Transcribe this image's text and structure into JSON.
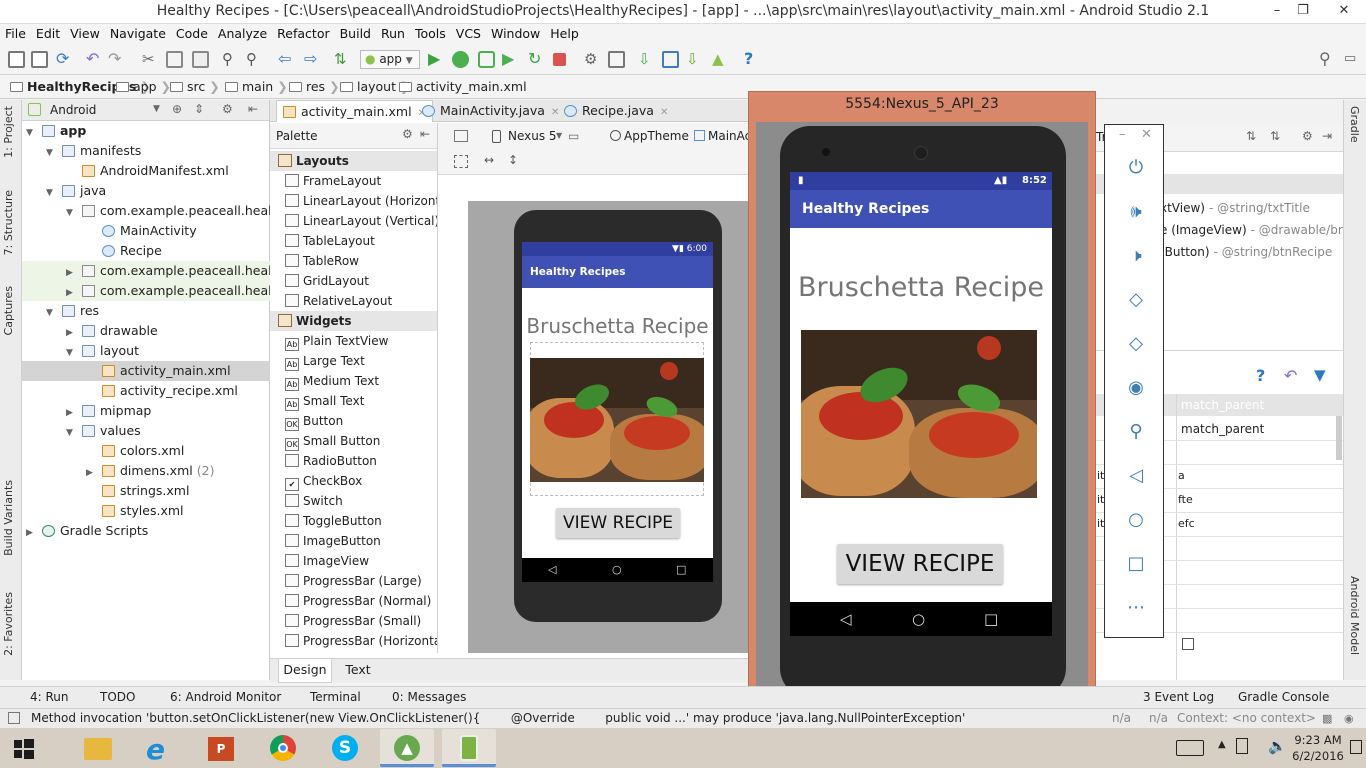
{
  "window": {
    "title": "Healthy Recipes - [C:\\Users\\peaceall\\AndroidStudioProjects\\HealthyRecipes] - [app] - ...\\app\\src\\main\\res\\layout\\activity_main.xml - Android Studio 2.1"
  },
  "menu": [
    "File",
    "Edit",
    "View",
    "Navigate",
    "Code",
    "Analyze",
    "Refactor",
    "Build",
    "Run",
    "Tools",
    "VCS",
    "Window",
    "Help"
  ],
  "toolbar": {
    "run_config": "app"
  },
  "breadcrumbs": [
    "HealthyRecipes",
    "app",
    "src",
    "main",
    "res",
    "layout",
    "activity_main.xml"
  ],
  "left_tabs": [
    "1: Project",
    "7: Structure",
    "Captures",
    "Build Variants",
    "2: Favorites"
  ],
  "right_tabs": [
    "Gradle",
    "Android Model"
  ],
  "project": {
    "view_mode": "Android",
    "tree": [
      {
        "label": "app",
        "depth": 0,
        "icon": "folder",
        "exp": "open",
        "bold": true
      },
      {
        "label": "manifests",
        "depth": 1,
        "icon": "folder",
        "exp": "open"
      },
      {
        "label": "AndroidManifest.xml",
        "depth": 2,
        "icon": "xml"
      },
      {
        "label": "java",
        "depth": 1,
        "icon": "folder",
        "exp": "open"
      },
      {
        "label": "com.example.peaceall.healthyre",
        "depth": 2,
        "icon": "package",
        "exp": "open"
      },
      {
        "label": "MainActivity",
        "depth": 3,
        "icon": "class"
      },
      {
        "label": "Recipe",
        "depth": 3,
        "icon": "class"
      },
      {
        "label": "com.example.peaceall.healthyre",
        "depth": 2,
        "icon": "package",
        "exp": "closed",
        "style": "pkg"
      },
      {
        "label": "com.example.peaceall.healthyre",
        "depth": 2,
        "icon": "package",
        "exp": "closed",
        "style": "pkg"
      },
      {
        "label": "res",
        "depth": 1,
        "icon": "folder",
        "exp": "open"
      },
      {
        "label": "drawable",
        "depth": 2,
        "icon": "folder",
        "exp": "closed"
      },
      {
        "label": "layout",
        "depth": 2,
        "icon": "folder",
        "exp": "open"
      },
      {
        "label": "activity_main.xml",
        "depth": 3,
        "icon": "xml",
        "style": "sel"
      },
      {
        "label": "activity_recipe.xml",
        "depth": 3,
        "icon": "xml"
      },
      {
        "label": "mipmap",
        "depth": 2,
        "icon": "folder",
        "exp": "closed"
      },
      {
        "label": "values",
        "depth": 2,
        "icon": "folder",
        "exp": "open"
      },
      {
        "label": "colors.xml",
        "depth": 3,
        "icon": "xml"
      },
      {
        "label": "dimens.xml",
        "depth": 3,
        "icon": "xml",
        "exp": "closed",
        "suffix": "(2)"
      },
      {
        "label": "strings.xml",
        "depth": 3,
        "icon": "xml"
      },
      {
        "label": "styles.xml",
        "depth": 3,
        "icon": "xml"
      },
      {
        "label": "Gradle Scripts",
        "depth": 0,
        "icon": "gradle",
        "exp": "closed"
      }
    ]
  },
  "editor_tabs": [
    {
      "label": "activity_main.xml",
      "active": true
    },
    {
      "label": "MainActivity.java"
    },
    {
      "label": "Recipe.java"
    }
  ],
  "palette": {
    "title": "Palette",
    "items": [
      {
        "label": "Layouts",
        "group": true
      },
      {
        "label": "FrameLayout"
      },
      {
        "label": "LinearLayout (Horizontal)"
      },
      {
        "label": "LinearLayout (Vertical)"
      },
      {
        "label": "TableLayout"
      },
      {
        "label": "TableRow"
      },
      {
        "label": "GridLayout"
      },
      {
        "label": "RelativeLayout"
      },
      {
        "label": "Widgets",
        "group": true
      },
      {
        "label": "Plain TextView",
        "glyph": "Ab"
      },
      {
        "label": "Large Text",
        "glyph": "Ab"
      },
      {
        "label": "Medium Text",
        "glyph": "Ab"
      },
      {
        "label": "Small Text",
        "glyph": "Ab"
      },
      {
        "label": "Button",
        "glyph": "OK"
      },
      {
        "label": "Small Button",
        "glyph": "OK"
      },
      {
        "label": "RadioButton"
      },
      {
        "label": "CheckBox",
        "glyph": "✔"
      },
      {
        "label": "Switch"
      },
      {
        "label": "ToggleButton"
      },
      {
        "label": "ImageButton"
      },
      {
        "label": "ImageView"
      },
      {
        "label": "ProgressBar (Large)"
      },
      {
        "label": "ProgressBar (Normal)"
      },
      {
        "label": "ProgressBar (Small)"
      },
      {
        "label": "ProgressBar (Horizontal)"
      }
    ]
  },
  "design_toolbar": {
    "device": "Nexus 5",
    "theme": "AppTheme",
    "activity": "MainAct"
  },
  "preview": {
    "time": "6:00",
    "app_title": "Healthy Recipes",
    "recipe_title": "Bruschetta Recipe",
    "button": "VIEW RECIPE"
  },
  "emulator": {
    "title": "5554:Nexus_5_API_23",
    "time": "8:52",
    "app_title": "Healthy Recipes",
    "recipe_title": "Bruschetta Recipe",
    "button": "VIEW RECIPE"
  },
  "component_tree": [
    {
      "label": "xtView)",
      "value": "- @string/txtTitle"
    },
    {
      "label": "e (ImageView)",
      "value": "- @drawable/brusch"
    },
    {
      "label": "(Button)",
      "value": "- @string/btnRecipe"
    }
  ],
  "properties": {
    "header_value": "match_parent",
    "row_value": "match_parent",
    "partial": [
      "ity",
      "ity",
      "ity"
    ],
    "partial_values": [
      "a",
      "fte",
      "efc"
    ]
  },
  "bottom_tabs": [
    "Design",
    "Text"
  ],
  "tool_windows": {
    "left": [
      "4: Run",
      "TODO",
      "6: Android Monitor",
      "Terminal",
      "0: Messages"
    ],
    "right": [
      "3  Event Log",
      "Gradle Console"
    ]
  },
  "status": {
    "message": "Method invocation 'button.setOnClickListener(new View.OnClickListener(){        @Override        public void ...' may produce 'java.lang.NullPointerException'",
    "na1": "n/a",
    "na2": "n/a",
    "context": "Context: <no context>"
  },
  "clock": {
    "time": "9:23 AM",
    "date": "6/2/2016"
  }
}
